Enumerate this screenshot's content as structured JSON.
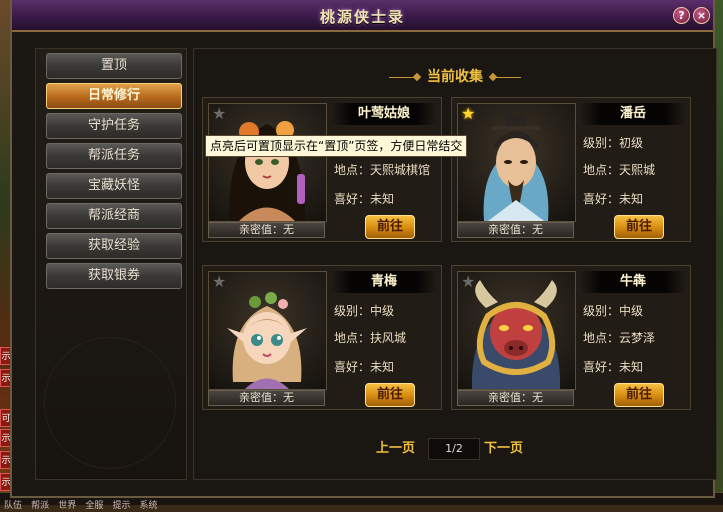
{
  "window": {
    "title": "桃源侠士录"
  },
  "side_tags": [
    "示",
    "示",
    "可",
    "示",
    "示",
    "示"
  ],
  "bottom_tabs": [
    "队伍",
    "帮派",
    "世界",
    "全服",
    "提示",
    "系统"
  ],
  "menu": [
    {
      "label": "置顶",
      "active": false
    },
    {
      "label": "日常修行",
      "active": true
    },
    {
      "label": "守护任务",
      "active": false
    },
    {
      "label": "帮派任务",
      "active": false
    },
    {
      "label": "宝藏妖怪",
      "active": false
    },
    {
      "label": "帮派经商",
      "active": false
    },
    {
      "label": "获取经验",
      "active": false
    },
    {
      "label": "获取银券",
      "active": false
    }
  ],
  "heading": "当前收集",
  "level_label": "级别：",
  "location_label": "地点：",
  "likes_label": "喜好：",
  "go_label": "前往",
  "cards": [
    {
      "name": "叶莺姑娘",
      "level": "",
      "location": "天熙城棋馆",
      "likes": "未知",
      "affinity": "亲密值：无",
      "starred": false
    },
    {
      "name": "潘岳",
      "level": "初级",
      "location": "天熙城",
      "likes": "未知",
      "affinity": "亲密值：无",
      "starred": true
    },
    {
      "name": "青梅",
      "level": "中级",
      "location": "扶风城",
      "likes": "未知",
      "affinity": "亲密值：无",
      "starred": false
    },
    {
      "name": "牛犇",
      "level": "中级",
      "location": "云梦泽",
      "likes": "未知",
      "affinity": "亲密值：无",
      "starred": false
    }
  ],
  "pagination": {
    "prev": "上一页",
    "next": "下一页",
    "current": "1/2"
  },
  "tooltip": "点亮后可置顶显示在“置顶”页签，方便日常结交",
  "icons": {
    "help": "?",
    "close": "×",
    "star": "★"
  }
}
